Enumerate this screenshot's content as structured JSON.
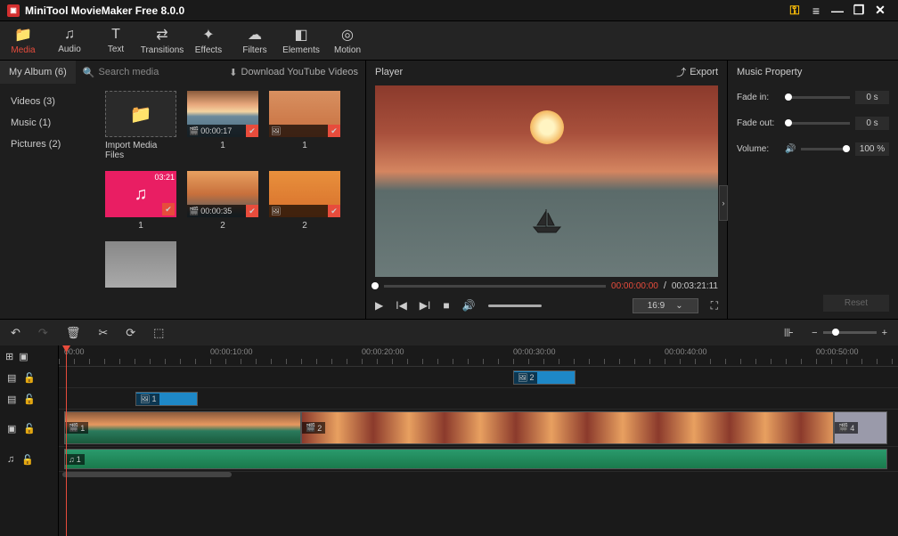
{
  "app": {
    "title": "MiniTool MovieMaker Free 8.0.0"
  },
  "ribbon": [
    {
      "label": "Media",
      "icon": "📁",
      "active": true
    },
    {
      "label": "Audio",
      "icon": "♫"
    },
    {
      "label": "Text",
      "icon": "T"
    },
    {
      "label": "Transitions",
      "icon": "⇄"
    },
    {
      "label": "Effects",
      "icon": "✦"
    },
    {
      "label": "Filters",
      "icon": "☁"
    },
    {
      "label": "Elements",
      "icon": "◧"
    },
    {
      "label": "Motion",
      "icon": "◎"
    }
  ],
  "media": {
    "album": "My Album (6)",
    "search": "Search media",
    "download": "Download YouTube Videos",
    "cats": [
      {
        "label": "Videos (3)"
      },
      {
        "label": "Music (1)"
      },
      {
        "label": "Pictures (2)"
      }
    ],
    "import_label": "Import Media Files",
    "thumbs": {
      "t1": {
        "dur": "00:00:17",
        "name": "1"
      },
      "t2": {
        "dur": "03:21",
        "name": "1"
      },
      "t3": {
        "name": "1"
      },
      "t4": {
        "name": "2",
        "dur": "00:00:35"
      },
      "t5": {
        "name": "2"
      }
    }
  },
  "player": {
    "title": "Player",
    "export": "Export",
    "pos": "00:00:00:00",
    "sep": " / ",
    "total": "00:03:21:11",
    "ratio": "16:9"
  },
  "props": {
    "title": "Music Property",
    "fadein": {
      "label": "Fade in:",
      "val": "0 s"
    },
    "fadeout": {
      "label": "Fade out:",
      "val": "0 s"
    },
    "volume": {
      "label": "Volume:",
      "val": "100 %"
    },
    "reset": "Reset"
  },
  "ruler": {
    "t0": "00:00",
    "t1": "00:00:10:00",
    "t2": "00:00:20:00",
    "t3": "00:00:30:00",
    "t4": "00:00:40:00",
    "t5": "00:00:50:00"
  },
  "clips": {
    "c1": "1",
    "c2": "2",
    "c3": "1",
    "c4": "2",
    "c5": "4",
    "a1": "1"
  }
}
